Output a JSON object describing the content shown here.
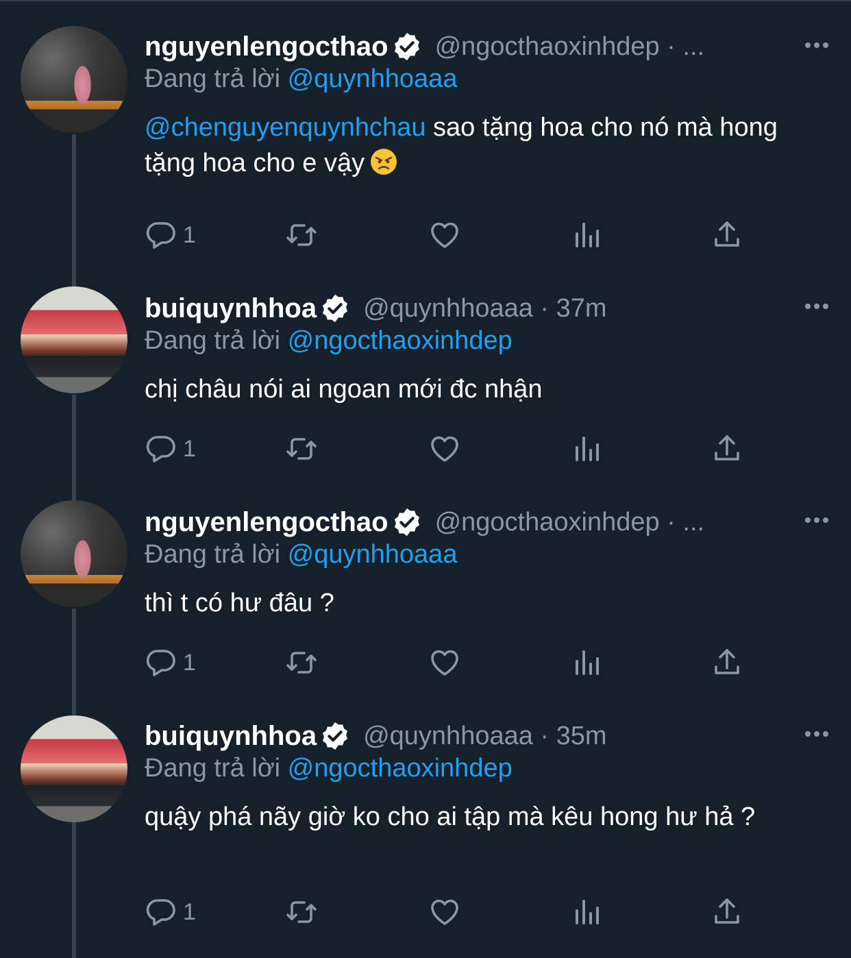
{
  "colors": {
    "background": "#15202b",
    "text": "#ffffff",
    "secondary": "#8899a6",
    "accent": "#1da1f2",
    "line": "#38444d"
  },
  "icons": [
    "verified-badge-icon",
    "more-icon",
    "reply-icon",
    "retweet-icon",
    "like-icon",
    "analytics-icon",
    "share-icon"
  ],
  "tweets": [
    {
      "name": "nguyenlengocthao",
      "handle": "@ngocthaoxinhdep · ...",
      "replying_prefix": "Đang trả lời ",
      "replying_to": "@quynhhoaaa",
      "mention": "@chenguyenquynhchau",
      "text": " sao tặng hoa cho nó mà hong tặng hoa cho e vậy",
      "emoji": "angry-face",
      "reply_count": "1"
    },
    {
      "name": "buiquynhhoa",
      "handle": "@quynhhoaaa · 37m",
      "replying_prefix": "Đang trả lời ",
      "replying_to": "@ngocthaoxinhdep",
      "text": "chị châu nói ai ngoan mới đc nhận",
      "reply_count": "1"
    },
    {
      "name": "nguyenlengocthao",
      "handle": "@ngocthaoxinhdep · ...",
      "replying_prefix": "Đang trả lời ",
      "replying_to": "@quynhhoaaa",
      "text": "thì t có hư đâu ?",
      "reply_count": "1"
    },
    {
      "name": "buiquynhhoa",
      "handle": "@quynhhoaaa · 35m",
      "replying_prefix": "Đang trả lời ",
      "replying_to": "@ngocthaoxinhdep",
      "text": "quậy phá nãy giờ ko cho ai tập mà kêu hong hư hả ?",
      "reply_count": "1"
    }
  ]
}
